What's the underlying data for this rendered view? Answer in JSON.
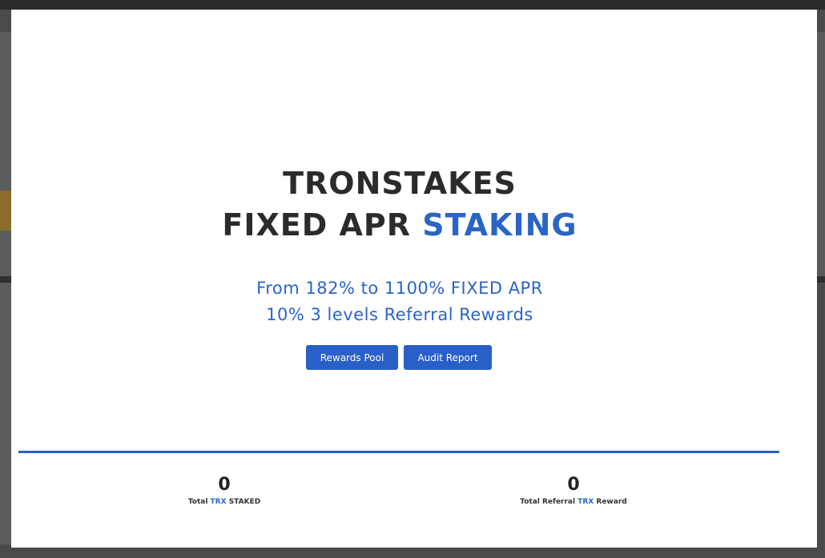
{
  "modal": {
    "title_line1": "TRONSTAKES",
    "title_line2_prefix": "FIXED APR",
    "title_line2_accent": "STAKING",
    "subtitle_line1": "From 182% to 1100% FIXED APR",
    "subtitle_line2": "10% 3 levels Referral Rewards",
    "buttons": {
      "rewards_pool": "Rewards Pool",
      "audit_report": "Audit Report"
    },
    "stats": [
      {
        "value": "0",
        "label_prefix": "Total",
        "label_accent": "TRX",
        "label_suffix": "STAKED"
      },
      {
        "value": "0",
        "label_prefix": "Total Referral",
        "label_accent": "TRX",
        "label_suffix": "Reward"
      }
    ]
  },
  "colors": {
    "accent": "#2a64c5",
    "button": "#2a5fc7",
    "title": "#2b2b2b"
  }
}
